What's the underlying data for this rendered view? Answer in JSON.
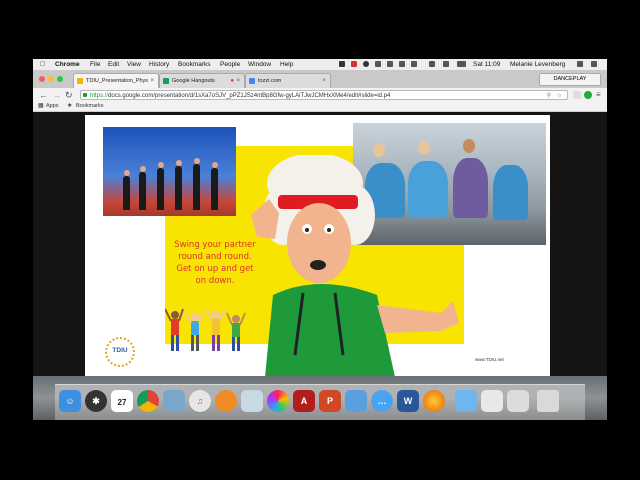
{
  "menubar": {
    "app": "Chrome",
    "items": [
      "File",
      "Edit",
      "View",
      "History",
      "Bookmarks",
      "People",
      "Window",
      "Help"
    ],
    "clock": "Sat 11:09",
    "user": "Melanie Levenberg"
  },
  "tabs": [
    {
      "title": "TDIU_Presentation_Phys",
      "active": true,
      "favicon_color": "#f4b400"
    },
    {
      "title": "Google Hangouts",
      "active": false,
      "favicon_color": "#0f9d58"
    },
    {
      "title": "tozzi.com",
      "active": false,
      "favicon_color": "#4285f4"
    }
  ],
  "profile_button": "DANCEPLAY",
  "address_bar": {
    "scheme": "https://",
    "url": "docs.google.com/presentation/d/1sXa7oSJV_pPZ1JSz4ntBp8Gfw-gyLAiTJwJCMHxXMe4/edit#slide=id.p4"
  },
  "bookmarks_bar": {
    "apps": "Apps",
    "bookmarks": "Bookmarks"
  },
  "slide": {
    "slogan_lines": [
      "Swing your partner",
      "round and round.",
      "Get on up and get",
      "on down."
    ],
    "logo_text": "TDIU",
    "footer_url": "www.TDIU.net"
  },
  "dock": {
    "calendar_day": "27",
    "icons": [
      "finder-icon",
      "launchpad-icon",
      "calendar-icon",
      "chrome-icon",
      "preview-icon",
      "itunes-icon",
      "books-icon",
      "photos-icon",
      "photo-app-icon",
      "acrobat-icon",
      "powerpoint-icon",
      "xcode-icon",
      "messages-icon",
      "word-icon",
      "firefox-icon",
      "folder-icon",
      "downloads-icon",
      "documents-icon",
      "trash-icon"
    ]
  }
}
